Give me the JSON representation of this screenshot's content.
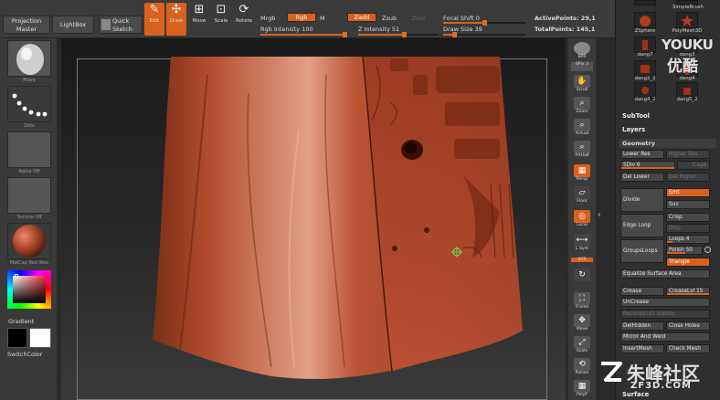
{
  "topbar": {
    "projection_master": "Projection Master",
    "lightbox": "LightBox",
    "quick_sketch": "Quick Sketch",
    "edit": "Edit",
    "draw": "Draw",
    "move": "Move",
    "scale": "Scale",
    "rotate": "Rotate",
    "mrgb": "Mrgb",
    "rgb": "Rgb",
    "m": "M",
    "zadd": "Zadd",
    "zsub": "Zsub",
    "zcut": "Zcut",
    "rgb_intensity_label": "Rgb Intensity",
    "rgb_intensity_value": "100",
    "z_intensity_label": "Z Intensity",
    "z_intensity_value": "51",
    "focal_shift_label": "Focal Shift",
    "focal_shift_value": "0",
    "draw_size_label": "Draw Size",
    "draw_size_value": "39",
    "active_points_label": "ActivePoints:",
    "active_points_value": "29,1",
    "total_points_label": "TotalPoints:",
    "total_points_value": "145,1"
  },
  "leftshelf": {
    "brush_label": "Move",
    "stroke_label": "Dots",
    "alpha_label": "Alpha Off",
    "texture_label": "Texture Off",
    "material_label": "MatCap Red Wax",
    "gradient_label": "Gradient",
    "switchcolor_label": "SwitchColor"
  },
  "rightshelf": {
    "bpr": "BPR",
    "spix": "SPix",
    "spix_value": "3",
    "scroll": "Scroll",
    "zoom": "Zoom",
    "actual": "Actual",
    "aahalf": "AAHalf",
    "persp": "Persp",
    "floor": "Floor",
    "local": "Local",
    "lsym": "L.Sym",
    "xyz": "XYZ",
    "frame": "Frame",
    "move": "Move",
    "scale": "Scale",
    "rotate": "Rotate",
    "polyf": "PolyF"
  },
  "toolpanel": {
    "tools": [
      "SimpleBrush",
      "ZSphere",
      "PolyMesh3D",
      "dang7",
      "dang3",
      "dang2_2",
      "dang4",
      "dang4_2",
      "dang5_2"
    ],
    "subtool": "SubTool",
    "layers": "Layers",
    "geometry": "Geometry",
    "lower_res": "Lower Res",
    "higher_res": "Higher Res",
    "sdiv": "SDiv",
    "sdiv_value": "6",
    "cage": "Cage",
    "del_lower": "Del Lower",
    "del_higher": "Del Higher",
    "divide": "Divide",
    "smt": "Smt",
    "suv": "Suv",
    "edge_loop": "Edge Loop",
    "crisp": "Crisp",
    "disp": "Disp",
    "loops_label": "Loops",
    "loops_value": "4",
    "groups_loops": "GroupsLoops",
    "polish_label": "Polish",
    "polish_value": "50",
    "triangle": "Triangle",
    "equalize": "Equalize Surface Area",
    "crease": "Crease",
    "crease_lvl_label": "CreaseLvl",
    "crease_lvl_value": "15",
    "uncrease": "UnCrease",
    "reconstruct": "Reconstruct Subdiv",
    "del_hidden": "DelHidden",
    "close_holes": "Close Holes",
    "mirror_weld": "Mirror And Weld",
    "insert_mesh": "InsertMesh",
    "check_mesh": "Check Mesh",
    "surface": "Surface"
  },
  "watermarks": {
    "youku_en": "YOUKU",
    "youku_cn": "优酷",
    "zf3d_cn": "朱峰社区",
    "zf3d_en": "ZF3D.COM"
  },
  "colors": {
    "accent": "#d9611d",
    "model": "#a9452b",
    "panel": "#2f2f2f"
  }
}
